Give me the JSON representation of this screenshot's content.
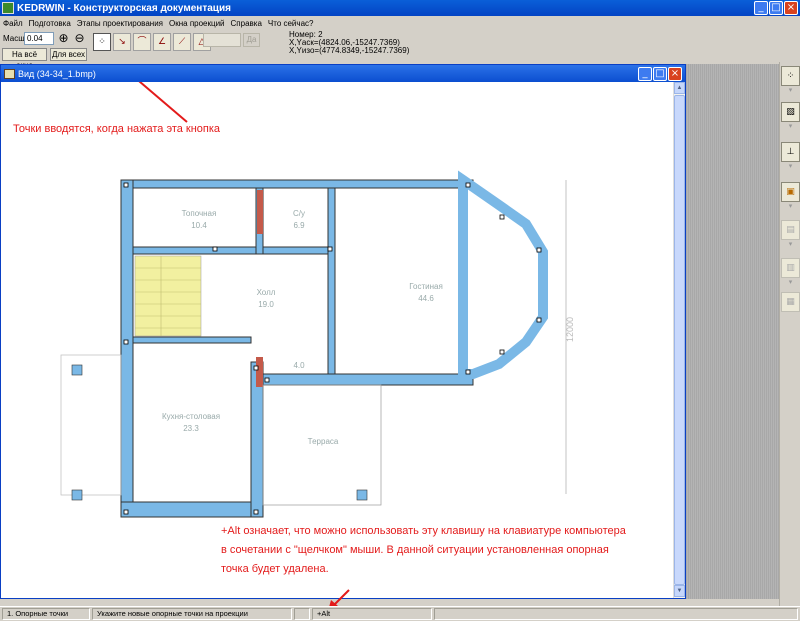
{
  "window": {
    "title": "KEDRWIN - Конструкторская документация"
  },
  "menu": [
    "Файл",
    "Подготовка",
    "Этапы проектирования",
    "Окна проекций",
    "Справка",
    "Что сейчас?"
  ],
  "toolbar": {
    "scale_label": "Масшт",
    "scale_value": "0.04",
    "fit_window": "На всё окно",
    "fit_all": "Для всех",
    "da_button": "Да"
  },
  "coords": {
    "number": "Номер: 2",
    "uask": "X,Yаск=(4824.06,-15247.7369)",
    "uizo": "X,Yизо=(4774.8349,-15247.7369)"
  },
  "child_window": {
    "title": "Вид (34-34_1.bmp)"
  },
  "annotations": {
    "button_note": "Точки вводятся, когда нажата эта кнопка",
    "alt_note_1": "+Alt означает, что можно использовать эту клавишу на клавиатуре компьютера",
    "alt_note_2": "в сочетании с \"щелчком\" мыши. В данной ситуации установленная опорная",
    "alt_note_3": "точка будет удалена."
  },
  "plan": {
    "rooms": [
      {
        "name": "Топочная",
        "area": "10.4"
      },
      {
        "name": "С/у",
        "area": "6.9"
      },
      {
        "name": "Холл",
        "area": "19.0"
      },
      {
        "name": "Гостиная",
        "area": "44.6"
      },
      {
        "name": "",
        "area": "4.0"
      },
      {
        "name": "Кухня-столовая",
        "area": "23.3"
      },
      {
        "name": "Терраса",
        "area": ""
      }
    ],
    "dimension": "12000"
  },
  "statusbar": {
    "mode": "1. Опорные точки",
    "hint": "Укажите новые опорные точки на проекции",
    "modifier": "+Alt"
  },
  "colors": {
    "title_bar": "#0343c4",
    "wall": "#7ab8e6",
    "stairs": "#f2f0a0",
    "annotation": "#e31b1b"
  }
}
